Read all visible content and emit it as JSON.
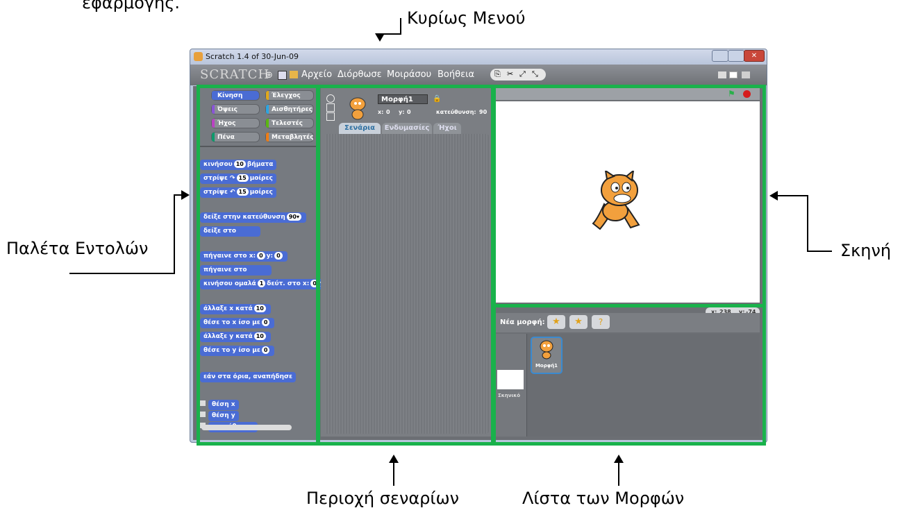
{
  "top_text": "εφαρμογής.",
  "callouts": {
    "menu": "Κυρίως Μενού",
    "palette": "Παλέτα Εντολών",
    "stage": "Σκηνή",
    "scripts": "Περιοχή σεναρίων",
    "sprites": "Λίστα των Μορφών"
  },
  "window": {
    "title": "Scratch 1.4 of 30-Jun-09",
    "logo": "SCRATCH",
    "menu_items": [
      "Αρχείο",
      "Διόρθωσε",
      "Μοιράσου",
      "Βοήθεια"
    ]
  },
  "palette": {
    "categories": [
      {
        "label": "Κίνηση",
        "color": "#4a6cd4"
      },
      {
        "label": "Έλεγχος",
        "color": "#e1a91a"
      },
      {
        "label": "Όψεις",
        "color": "#8a55d7"
      },
      {
        "label": "Αισθητήρες",
        "color": "#2ca5e2"
      },
      {
        "label": "Ήχος",
        "color": "#bb42c3"
      },
      {
        "label": "Τελεστές",
        "color": "#5cb712"
      },
      {
        "label": "Πένα",
        "color": "#0e9a6c"
      },
      {
        "label": "Μεταβλητές",
        "color": "#ee7d16"
      }
    ],
    "blocks": {
      "move_a": "κινήσου",
      "move_val": "10",
      "move_b": "βήματα",
      "turn_r_a": "στρίψε ↷",
      "turn_r_val": "15",
      "turn_r_b": "μοίρες",
      "turn_l_a": "στρίψε ↶",
      "turn_l_val": "15",
      "turn_l_b": "μοίρες",
      "point_dir": "δείξε στην κατεύθυνση",
      "point_dir_val": "90▾",
      "point_to": "δείξε στο",
      "goto_xy_a": "πήγαινε στο x:",
      "goto_xy_x": "0",
      "goto_xy_b": "y:",
      "goto_xy_y": "0",
      "goto": "πήγαινε στο",
      "glide_a": "κινήσου ομαλά",
      "glide_val": "1",
      "glide_b": "δεύτ. στο x:",
      "glide_x": "0",
      "glide_c": "y",
      "change_x": "άλλαξε x κατά",
      "change_x_val": "10",
      "set_x": "θέσε το x ίσο με",
      "set_x_val": "0",
      "change_y": "άλλαξε y κατά",
      "change_y_val": "10",
      "set_y": "θέσε το y ίσο με",
      "set_y_val": "0",
      "bounce": "εάν στα όρια, αναπήδησε",
      "rep_x": "θέση x",
      "rep_y": "θέση y",
      "rep_dir": "κατεύθυνση"
    }
  },
  "sprite_info": {
    "name": "Μορφή1",
    "x_label": "x:",
    "x_val": "0",
    "y_label": "y:",
    "y_val": "0",
    "dir_label": "κατεύθυνση:",
    "dir_val": "90"
  },
  "tabs": [
    "Σενάρια",
    "Ενδυμασίες",
    "Ήχοι"
  ],
  "stage": {
    "coords_x_label": "x:",
    "coords_x": "238",
    "coords_y_label": "y:",
    "coords_y": "-74",
    "new_sprite_label": "Νέα μορφή:"
  },
  "sprite_list": {
    "sprite_name": "Μορφή1",
    "stage_label": "Σκηνικό"
  },
  "colors": {
    "highlight": "#19b24b",
    "motion": "#4a6cd4"
  }
}
